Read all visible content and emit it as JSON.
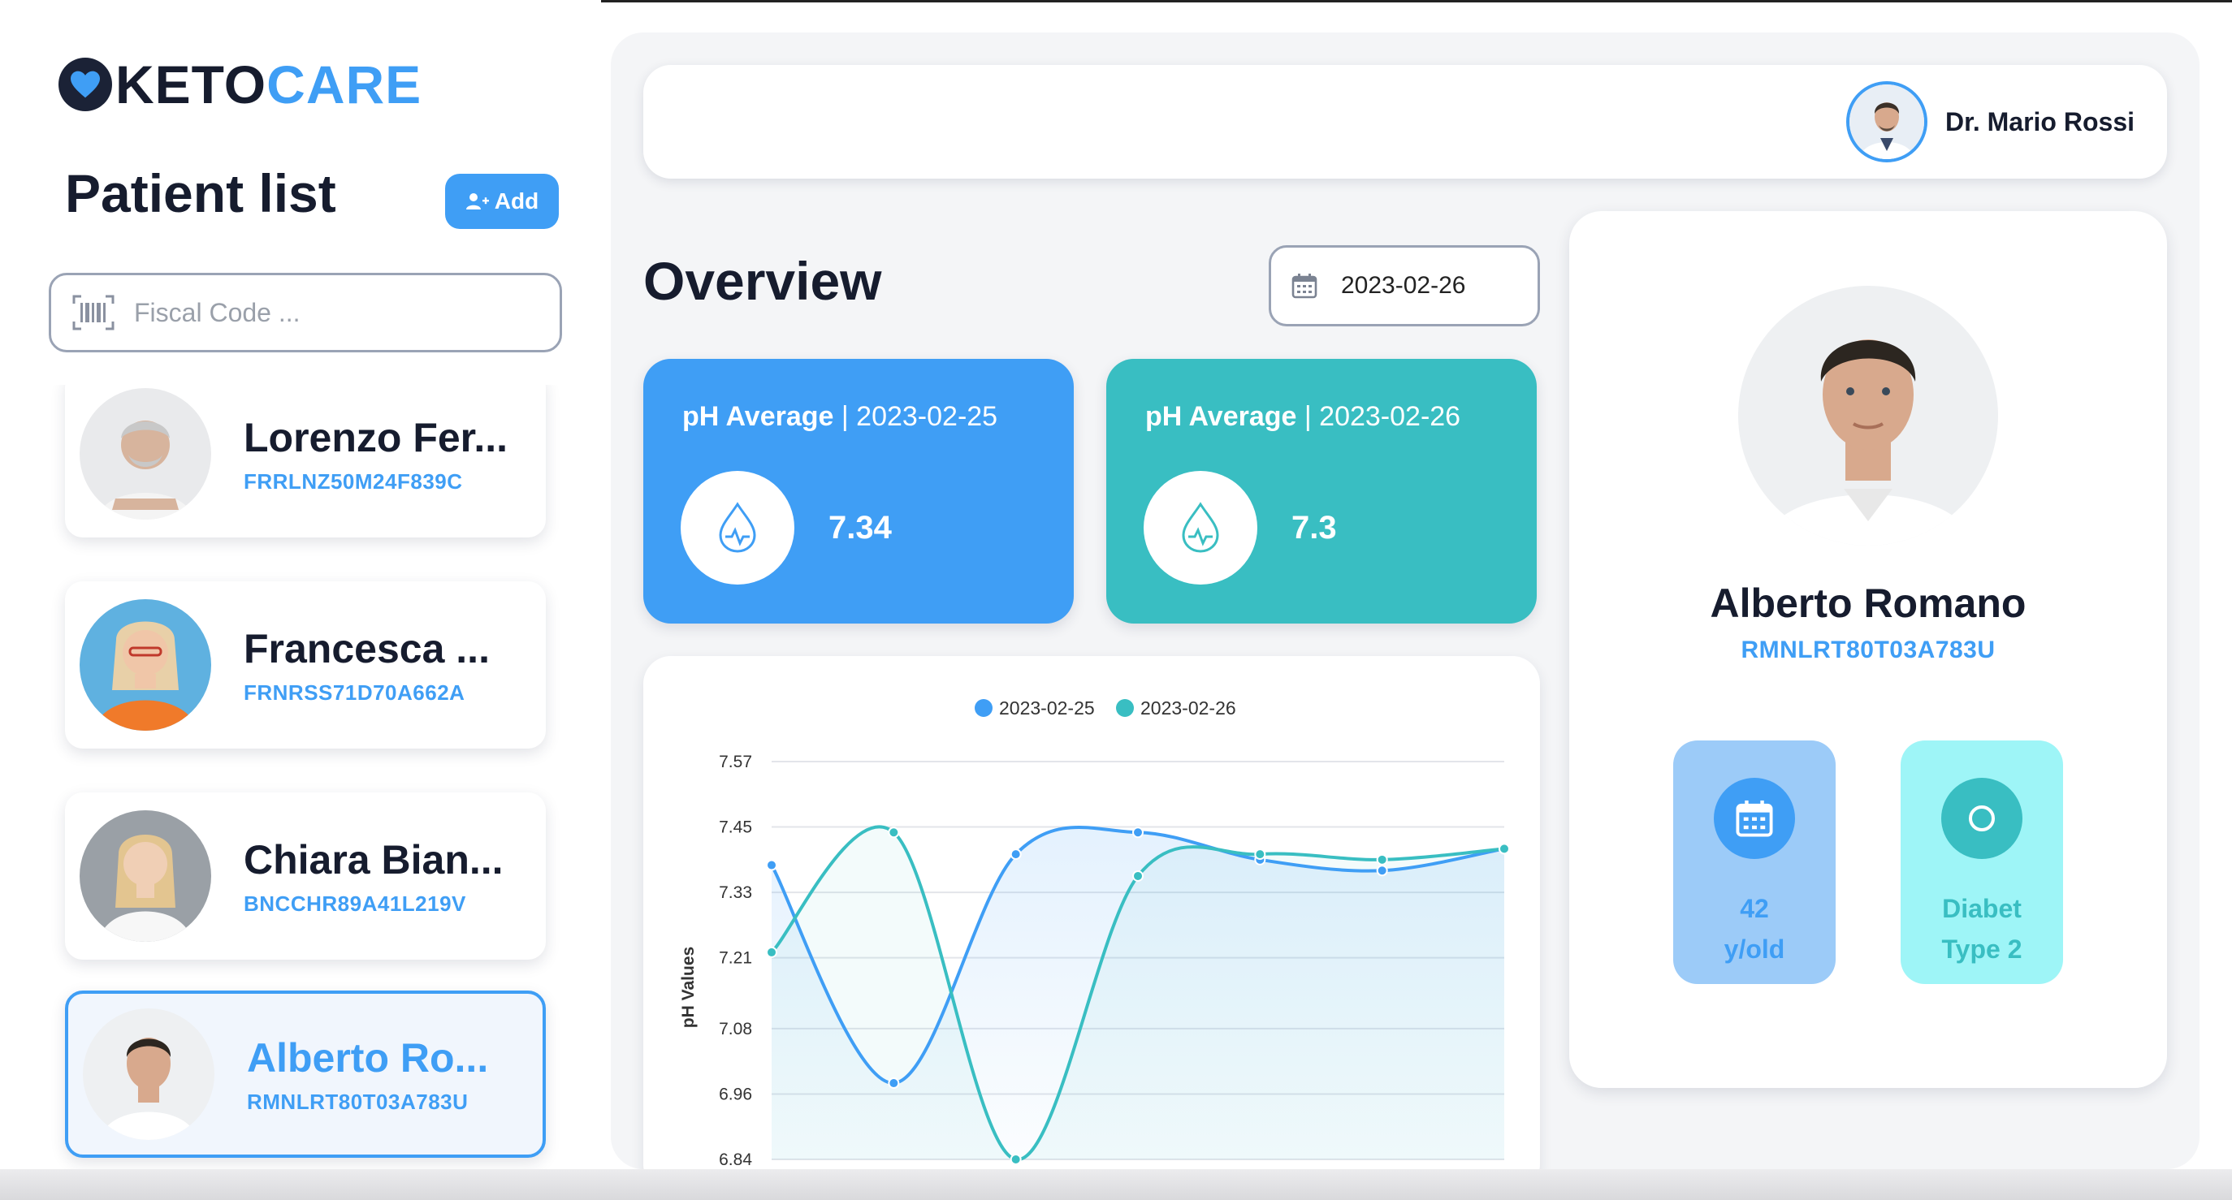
{
  "brand": {
    "part1": "KETO",
    "part2": "CARE"
  },
  "sidebar": {
    "title": "Patient list",
    "add_label": "Add",
    "search_placeholder": "Fiscal Code ...",
    "patients": [
      {
        "name": "Lorenzo Fer...",
        "code": "FRRLNZ50M24F839C",
        "bg": "#e9eaec",
        "skin": "#d7b49d",
        "hair": "#c8c8c8",
        "shirt": "#f4f4f4"
      },
      {
        "name": "Francesca ...",
        "code": "FRNRSS71D70A662A",
        "bg": "#5fb1e0",
        "skin": "#f0c6a8",
        "hair": "#e8d0a8",
        "shirt": "#f07a2a"
      },
      {
        "name": "Chiara Bian...",
        "code": "BNCCHR89A41L219V",
        "bg": "#9aa0a6",
        "skin": "#f0cfb5",
        "hair": "#e3c590",
        "shirt": "#f7f7f7"
      },
      {
        "name": "Alberto Ro...",
        "code": "RMNLRT80T03A783U",
        "bg": "#eef0f2",
        "skin": "#d8a98d",
        "hair": "#2c2620",
        "shirt": "#ffffff",
        "active": true
      }
    ]
  },
  "header": {
    "doctor_name": "Dr. Mario Rossi"
  },
  "overview": {
    "title": "Overview",
    "date": "2023-02-26",
    "cards": [
      {
        "label_bold": "pH Average",
        "label_rest": " | 2023-02-25",
        "value": "7.34",
        "color": "#3f9ef5"
      },
      {
        "label_bold": "pH Average",
        "label_rest": " | 2023-02-26",
        "value": "7.3",
        "color": "#39bec2"
      }
    ]
  },
  "chart_data": {
    "type": "line",
    "ylabel": "pH Values",
    "xlabel": "",
    "yticks": [
      "7.57",
      "7.45",
      "7.33",
      "7.21",
      "7.08",
      "6.96",
      "6.84"
    ],
    "ylim": [
      6.84,
      7.57
    ],
    "x": [
      1,
      2,
      3,
      4,
      5,
      6,
      7
    ],
    "series": [
      {
        "name": "2023-02-25",
        "color": "#3f9ef5",
        "values": [
          7.38,
          6.98,
          7.4,
          7.44,
          7.39,
          7.37,
          7.41
        ]
      },
      {
        "name": "2023-02-26",
        "color": "#39bec2",
        "values": [
          7.22,
          7.44,
          6.84,
          7.36,
          7.4,
          7.39,
          7.41
        ]
      }
    ]
  },
  "profile": {
    "name": "Alberto Romano",
    "code": "RMNLRT80T03A783U",
    "age_line1": "42",
    "age_line2": "y/old",
    "diag_line1": "Diabet",
    "diag_line2": "Type 2"
  }
}
